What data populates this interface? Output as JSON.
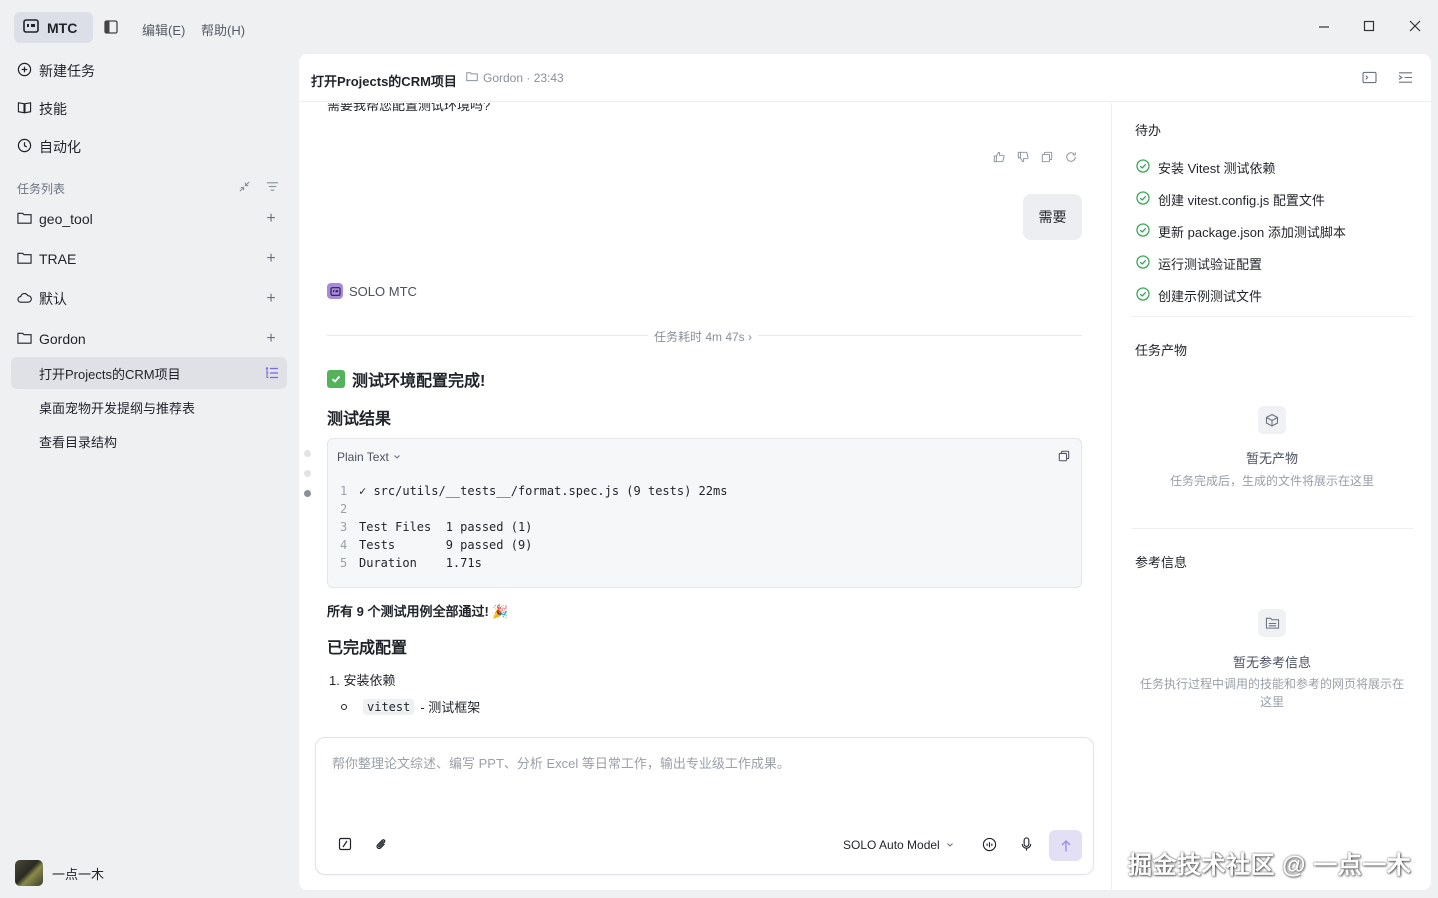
{
  "window": {
    "app_name": "MTC",
    "menu": [
      "编辑(E)",
      "帮助(H)"
    ]
  },
  "sidebar": {
    "nav": [
      {
        "label": "新建任务",
        "icon": "plus-circle-icon"
      },
      {
        "label": "技能",
        "icon": "book-icon"
      },
      {
        "label": "自动化",
        "icon": "clock-icon"
      }
    ],
    "task_list_label": "任务列表",
    "folders": [
      {
        "label": "geo_tool",
        "icon": "folder-icon"
      },
      {
        "label": "TRAE",
        "icon": "folder-icon"
      },
      {
        "label": "默认",
        "icon": "cloud-icon"
      },
      {
        "label": "Gordon",
        "icon": "folder-icon"
      }
    ],
    "tasks": [
      {
        "label": "打开Projects的CRM项目",
        "active": true
      },
      {
        "label": "桌面宠物开发提纲与推荐表",
        "active": false
      },
      {
        "label": "查看目录结构",
        "active": false
      }
    ],
    "user_name": "一点一木"
  },
  "header": {
    "title": "打开Projects的CRM项目",
    "meta": "Gordon · 23:43"
  },
  "chat": {
    "partial_text": "需要我帮您配置测试环境吗?",
    "user_reply": "需要",
    "agent_name": "SOLO MTC",
    "duration": "任务耗时 4m 47s",
    "done_heading": "测试环境配置完成!",
    "results_heading": "测试结果",
    "code_lang": "Plain Text",
    "code_lines": [
      {
        "n": "1",
        "text": "✓ src/utils/__tests__/format.spec.js (9 tests) 22ms"
      },
      {
        "n": "2",
        "text": ""
      },
      {
        "n": "3",
        "text": "Test Files  1 passed (1)"
      },
      {
        "n": "4",
        "text": "Tests       9 passed (9)"
      },
      {
        "n": "5",
        "text": "Duration    1.71s"
      }
    ],
    "pass_summary": "所有 9 个测试用例全部通过! 🎉",
    "config_heading": "已完成配置",
    "ol_item": "1. 安装依赖",
    "li_code": "vitest",
    "li_text": "- 测试框架"
  },
  "composer": {
    "placeholder": "帮你整理论文综述、编写 PPT、分析 Excel 等日常工作，输出专业级工作成果。",
    "model": "SOLO Auto Model"
  },
  "right_panel": {
    "todo_title": "待办",
    "todos": [
      "安装 Vitest 测试依赖",
      "创建 vitest.config.js 配置文件",
      "更新 package.json 添加测试脚本",
      "运行测试验证配置",
      "创建示例测试文件"
    ],
    "artifacts_title": "任务产物",
    "artifacts_empty_title": "暂无产物",
    "artifacts_empty_desc": "任务完成后，生成的文件将展示在这里",
    "refs_title": "参考信息",
    "refs_empty_title": "暂无参考信息",
    "refs_empty_desc": "任务执行过程中调用的技能和参考的网页将展示在这里"
  },
  "watermark": "掘金技术社区 @ 一点一木",
  "colors": {
    "accent": "#a78bda",
    "success": "#3aa55a",
    "sidebar_bg": "#eff0f2",
    "active_task_bg": "#dfe1e6"
  }
}
